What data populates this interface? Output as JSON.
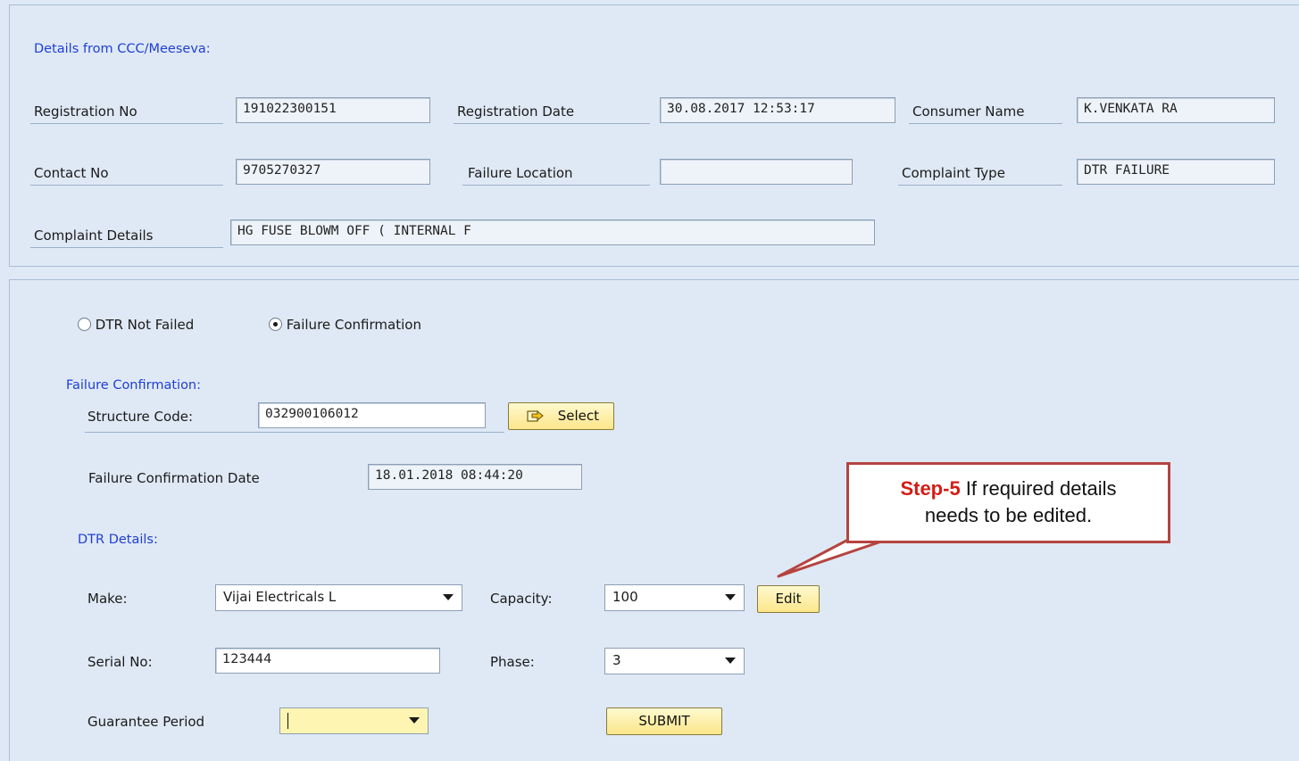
{
  "ccc": {
    "title": "Details from CCC/Meeseva:",
    "registration_no_label": "Registration No",
    "registration_no": "191022300151",
    "registration_date_label": "Registration Date",
    "registration_date": "30.08.2017 12:53:17",
    "consumer_name_label": "Consumer Name",
    "consumer_name": "K.VENKATA RA",
    "contact_no_label": "Contact No",
    "contact_no": "9705270327",
    "failure_location_label": "Failure Location",
    "failure_location": "",
    "complaint_type_label": "Complaint Type",
    "complaint_type": "DTR FAILURE",
    "complaint_details_label": "Complaint Details",
    "complaint_details": "HG FUSE BLOWM OFF ( INTERNAL F"
  },
  "options": {
    "not_failed_label": "DTR Not Failed",
    "not_failed_selected": false,
    "confirmation_label": "Failure Confirmation",
    "confirmation_selected": true
  },
  "failure": {
    "title": "Failure Confirmation:",
    "structure_code_label": "Structure Code:",
    "structure_code": "032900106012",
    "select_button": "Select",
    "confirmation_date_label": "Failure Confirmation Date",
    "confirmation_date": "18.01.2018 08:44:20"
  },
  "dtr": {
    "title": "DTR Details:",
    "make_label": "Make:",
    "make": "Vijai Electricals L",
    "capacity_label": "Capacity:",
    "capacity": "100",
    "edit_button": "Edit",
    "serial_label": "Serial No:",
    "serial": "123444",
    "phase_label": "Phase:",
    "phase": "3",
    "guarantee_label": "Guarantee Period",
    "guarantee": "",
    "submit_button": "SUBMIT"
  },
  "callout": {
    "step": "Step-5",
    "text_line1": " If required details",
    "text_line2": "needs to be edited."
  },
  "colors": {
    "background": "#dfe9f5",
    "section_title": "#1f3fd6",
    "button_yellow": "#fbe68a",
    "callout_border": "#b5443f",
    "callout_step": "#d41c16"
  },
  "icons": {
    "select_button_icon": "arrow-right-icon"
  }
}
